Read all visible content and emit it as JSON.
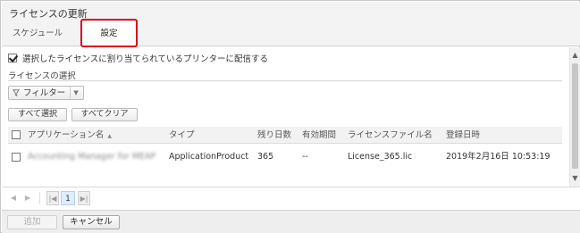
{
  "window": {
    "title": "ライセンスの更新"
  },
  "tabs": [
    {
      "label": "スケジュール",
      "selected": false
    },
    {
      "label": "設定",
      "selected": true
    }
  ],
  "distribution": {
    "label": "選択したライセンスに割り当てられているプリンターに配信する",
    "checked": true
  },
  "license_selection": {
    "label": "ライセンスの選択",
    "filter_label": "フィルター",
    "select_all_label": "すべて選択",
    "clear_all_label": "すべてクリア"
  },
  "table": {
    "columns": [
      "アプリケーション名",
      "タイプ",
      "残り日数",
      "有効期間",
      "ライセンスファイル名",
      "登録日時"
    ],
    "rows": [
      {
        "application": "Accounting Manager for MEAP",
        "type": "ApplicationProduct",
        "remaining_days": "365",
        "validity": "--",
        "license_file": "License_365.lic",
        "registered": "2019年2月16日 10:53:19",
        "checked": false
      }
    ]
  },
  "pager": {
    "current_page": "1"
  },
  "footer": {
    "add_label": "追加",
    "cancel_label": "キャンセル"
  },
  "colors": {
    "tab_highlight": "#e0001a",
    "page_active": "#dceeff"
  },
  "icons": [
    "filter-icon",
    "sort-ascending-icon",
    "chevron-down-icon",
    "scroll-up-icon",
    "scroll-down-icon",
    "prev-page-icon",
    "next-page-icon",
    "first-page-icon",
    "last-page-icon"
  ]
}
